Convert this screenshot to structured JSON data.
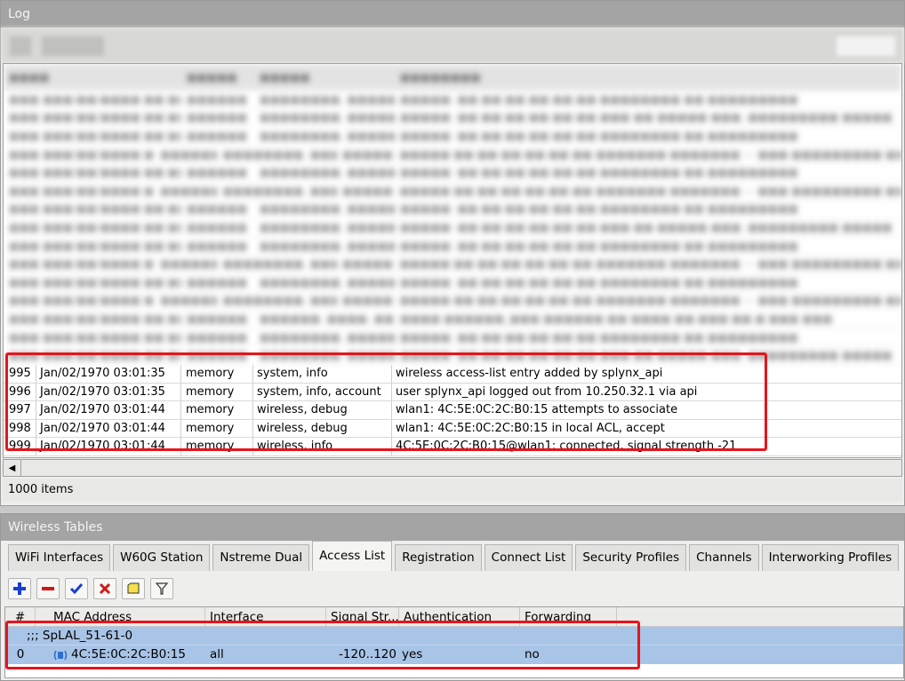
{
  "log_window": {
    "title": "Log",
    "status": "1000 items",
    "rows": [
      {
        "num": "995",
        "time": "Jan/02/1970 03:01:35",
        "buffer": "memory",
        "topics": "system, info",
        "message": "wireless access-list entry added by splynx_api"
      },
      {
        "num": "996",
        "time": "Jan/02/1970 03:01:35",
        "buffer": "memory",
        "topics": "system, info, account",
        "message": "user splynx_api logged out from 10.250.32.1 via api"
      },
      {
        "num": "997",
        "time": "Jan/02/1970 03:01:44",
        "buffer": "memory",
        "topics": "wireless, debug",
        "message": "wlan1: 4C:5E:0C:2C:B0:15 attempts to associate"
      },
      {
        "num": "998",
        "time": "Jan/02/1970 03:01:44",
        "buffer": "memory",
        "topics": "wireless, debug",
        "message": "wlan1: 4C:5E:0C:2C:B0:15 in local ACL, accept"
      },
      {
        "num": "999",
        "time": "Jan/02/1970 03:01:44",
        "buffer": "memory",
        "topics": "wireless, info",
        "message": "4C:5E:0C:2C:B0:15@wlan1: connected, signal strength -21"
      }
    ]
  },
  "wireless_window": {
    "title": "Wireless Tables",
    "tabs": [
      {
        "label": "WiFi Interfaces"
      },
      {
        "label": "W60G Station"
      },
      {
        "label": "Nstreme Dual"
      },
      {
        "label": "Access List"
      },
      {
        "label": "Registration"
      },
      {
        "label": "Connect List"
      },
      {
        "label": "Security Profiles"
      },
      {
        "label": "Channels"
      },
      {
        "label": "Interworking Profiles"
      }
    ],
    "active_tab": "Access List",
    "toolbar_icons": [
      "add-icon",
      "remove-icon",
      "enable-icon",
      "disable-icon",
      "comment-icon",
      "filter-icon"
    ],
    "columns": {
      "num": "#",
      "mac": "MAC Address",
      "interface": "Interface",
      "signal": "Signal Str...",
      "auth": "Authentication",
      "forwarding": "Forwarding"
    },
    "comment": ";;; SpLAL_51-61-0",
    "entry": {
      "num": "0",
      "mac": "4C:5E:0C:2C:B0:15",
      "interface": "all",
      "signal": "-120..120",
      "auth": "yes",
      "forwarding": "no"
    }
  },
  "colors": {
    "highlight": "#e6151c",
    "selected_row": "#a8c4e6",
    "titlebar": "#a4a4a4"
  }
}
